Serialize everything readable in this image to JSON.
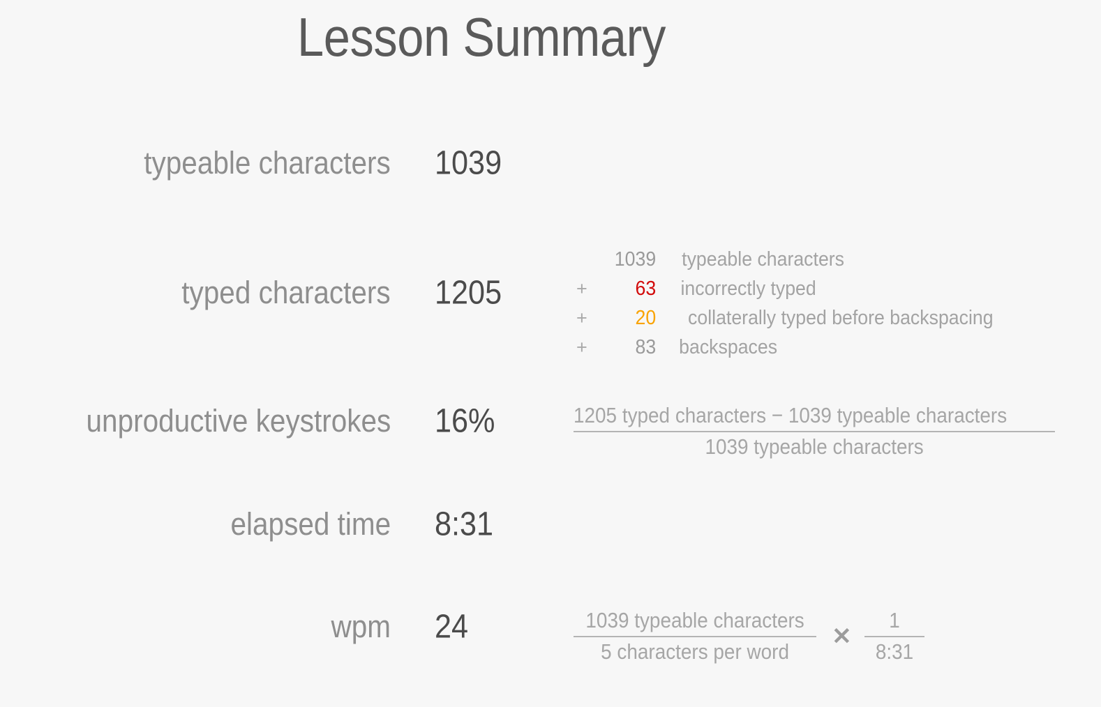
{
  "page": {
    "title": "Lesson Summary",
    "background_color": "#f7f7f7",
    "label_color": "#8e8e8e",
    "value_color": "#4b4b4b",
    "muted_color": "#a6a6a6",
    "error_color": "#d20b0b",
    "warning_color": "#f9a302"
  },
  "stats": [
    {
      "label": "typeable characters",
      "value": "1039"
    },
    {
      "label": "typed characters",
      "value": "1205"
    },
    {
      "label": "unproductive keystrokes",
      "value": "16%"
    },
    {
      "label": "elapsed time",
      "value": "8:31"
    },
    {
      "label": "wpm",
      "value": "24"
    }
  ],
  "typed_breakdown": [
    {
      "op": "",
      "number": "1039",
      "text": "typeable characters",
      "color": "default"
    },
    {
      "op": "+",
      "number": "63",
      "text": "incorrectly typed",
      "color": "red"
    },
    {
      "op": "+",
      "number": "20",
      "text": "collaterally typed before backspacing",
      "color": "amber"
    },
    {
      "op": "+",
      "number": "83",
      "text": "backspaces",
      "color": "default"
    }
  ],
  "unproductive_formula": {
    "numerator": "1205 typed characters − 1039 typeable characters",
    "denominator": "1039 typeable characters"
  },
  "wpm_formula": {
    "chars_numerator": "1039 typeable characters",
    "chars_denominator": "5 characters per word",
    "operator": "✕",
    "time_numerator": "1",
    "time_denominator": "8:31"
  }
}
